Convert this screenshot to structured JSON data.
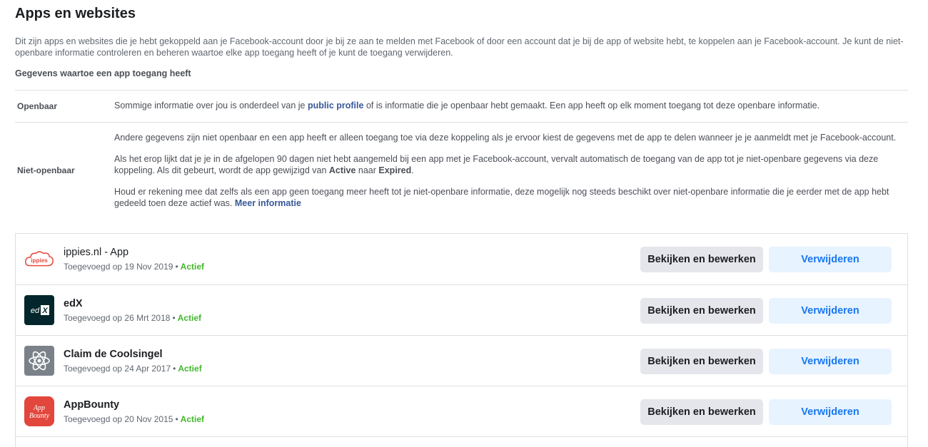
{
  "page": {
    "title": "Apps en websites",
    "intro": "Dit zijn apps en websites die je hebt gekoppeld aan je Facebook-account door je bij ze aan te melden met Facebook of door een account dat je bij de app of website hebt, te koppelen aan je Facebook-account. Je kunt de niet-openbare informatie controleren en beheren waartoe elke app toegang heeft of je kunt de toegang verwijderen.",
    "subheading": "Gegevens waartoe een app toegang heeft"
  },
  "info": {
    "public": {
      "label": "Openbaar",
      "text_before": "Sommige informatie over jou is onderdeel van je ",
      "link": "public profile",
      "text_after": " of is informatie die je openbaar hebt gemaakt. Een app heeft op elk moment toegang tot deze openbare informatie."
    },
    "private": {
      "label": "Niet-openbaar",
      "p1": "Andere gegevens zijn niet openbaar en een app heeft er alleen toegang toe via deze koppeling als je ervoor kiest de gegevens met de app te delen wanneer je je aanmeldt met je Facebook-account.",
      "p2_before": "Als het erop lijkt dat je je in de afgelopen 90 dagen niet hebt aangemeld bij een app met je Facebook-account, vervalt automatisch de toegang van de app tot je niet-openbare gegevens via deze koppeling. Als dit gebeurt, wordt de app gewijzigd van ",
      "p2_active": "Active",
      "p2_middle": " naar ",
      "p2_expired": "Expired",
      "p2_end": ".",
      "p3_before": "Houd er rekening mee dat zelfs als een app geen toegang meer heeft tot je niet-openbare informatie, deze mogelijk nog steeds beschikt over niet-openbare informatie die je eerder met de app hebt gedeeld toen deze actief was. ",
      "p3_link": "Meer informatie"
    }
  },
  "buttons": {
    "edit": "Bekijken en bewerken",
    "remove": "Verwijderen"
  },
  "apps": [
    {
      "name": "ippies.nl - App",
      "added": "Toegevoegd op 19 Nov 2019",
      "status": "Actief",
      "icon": "ippies-cloud-icon",
      "icon_text": "ippies"
    },
    {
      "name": "edX",
      "added": "Toegevoegd op 26 Mrt 2018",
      "status": "Actief",
      "icon": "edx-icon",
      "icon_text": "edX"
    },
    {
      "name": "Claim de Coolsingel",
      "added": "Toegevoegd op 24 Apr 2017",
      "status": "Actief",
      "icon": "atom-icon",
      "icon_text": ""
    },
    {
      "name": "AppBounty",
      "added": "Toegevoegd op 20 Nov 2015",
      "status": "Actief",
      "icon": "appbounty-icon",
      "icon_text": "App Bounty"
    }
  ],
  "colors": {
    "active": "#42b72a",
    "link": "#385898",
    "remove_text": "#1877f2",
    "remove_bg": "#e7f3ff",
    "edit_bg": "#e4e6eb"
  }
}
